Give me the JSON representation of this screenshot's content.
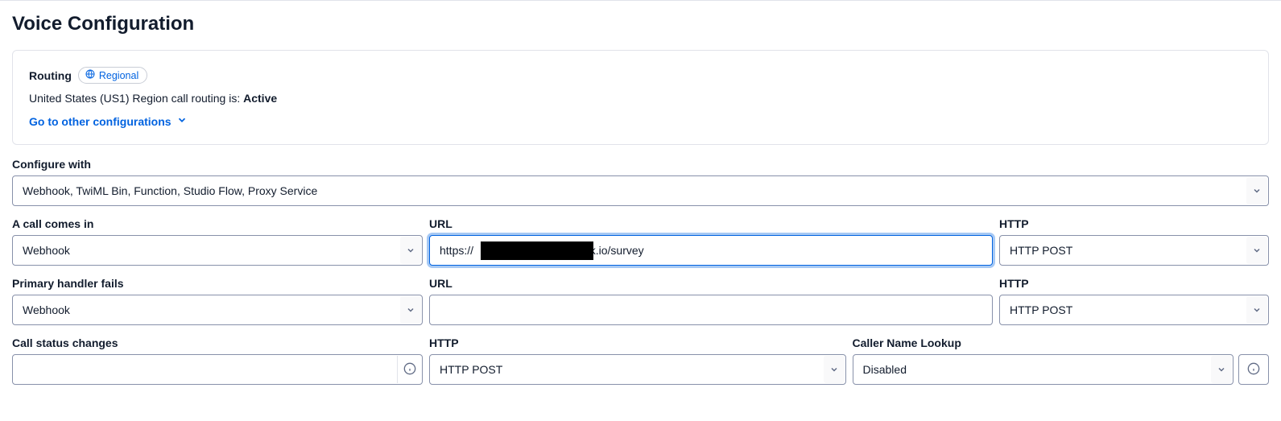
{
  "page_title": "Voice Configuration",
  "routing": {
    "label": "Routing",
    "badge_text": "Regional",
    "status_prefix": "United States (US1) Region call routing is: ",
    "status_value": "Active",
    "link_text": "Go to other configurations"
  },
  "configure_with": {
    "label": "Configure with",
    "value": "Webhook, TwiML Bin, Function, Studio Flow, Proxy Service"
  },
  "call_comes_in": {
    "label": "A call comes in",
    "handler": "Webhook",
    "url_label": "URL",
    "url_prefix": "https://",
    "url_suffix": ".ngrok.io/survey",
    "http_label": "HTTP",
    "http_method": "HTTP POST"
  },
  "primary_fails": {
    "label": "Primary handler fails",
    "handler": "Webhook",
    "url_label": "URL",
    "url_value": "",
    "http_label": "HTTP",
    "http_method": "HTTP POST"
  },
  "call_status": {
    "label": "Call status changes",
    "url_value": "",
    "http_label": "HTTP",
    "http_method": "HTTP POST"
  },
  "caller_name": {
    "label": "Caller Name Lookup",
    "value": "Disabled"
  }
}
